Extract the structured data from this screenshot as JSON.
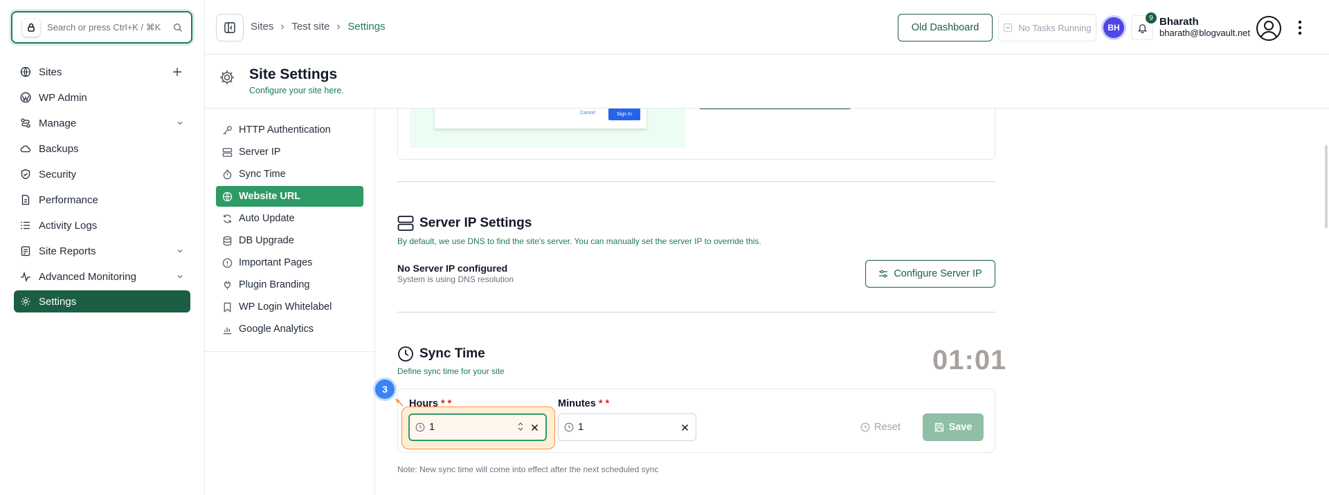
{
  "search": {
    "placeholder": "Search or press Ctrl+K / ⌘K"
  },
  "sidebar": {
    "items": [
      {
        "label": "Sites",
        "icon": "globe-icon"
      },
      {
        "label": "WP Admin",
        "icon": "wordpress-icon"
      },
      {
        "label": "Manage",
        "icon": "manage-icon"
      },
      {
        "label": "Backups",
        "icon": "cloud-icon"
      },
      {
        "label": "Security",
        "icon": "shield-icon"
      },
      {
        "label": "Performance",
        "icon": "document-icon"
      },
      {
        "label": "Activity Logs",
        "icon": "list-icon"
      },
      {
        "label": "Site Reports",
        "icon": "report-icon"
      },
      {
        "label": "Advanced Monitoring",
        "icon": "pulse-icon"
      },
      {
        "label": "Settings",
        "icon": "gear-icon"
      }
    ]
  },
  "header": {
    "breadcrumbs": [
      "Sites",
      "Test site",
      "Settings"
    ],
    "old_dashboard": "Old Dashboard",
    "tasks": "No Tasks Running",
    "avatar_initials": "BH",
    "notif_count": "9",
    "user_name": "Bharath",
    "user_email": "bharath@blogvault.net"
  },
  "page": {
    "title": "Site Settings",
    "subtitle": "Configure your site here."
  },
  "settings_nav": [
    {
      "label": "HTTP Authentication",
      "icon": "key-icon"
    },
    {
      "label": "Server IP",
      "icon": "server-icon"
    },
    {
      "label": "Sync Time",
      "icon": "timer-icon"
    },
    {
      "label": "Website URL",
      "icon": "globe-icon"
    },
    {
      "label": "Auto Update",
      "icon": "refresh-icon"
    },
    {
      "label": "DB Upgrade",
      "icon": "database-icon"
    },
    {
      "label": "Important Pages",
      "icon": "info-icon"
    },
    {
      "label": "Plugin Branding",
      "icon": "plug-icon"
    },
    {
      "label": "WP Login Whitelabel",
      "icon": "bookmark-icon"
    },
    {
      "label": "Google Analytics",
      "icon": "chart-icon"
    }
  ],
  "login_preview": {
    "cancel": "Cancel",
    "sign_in": "Sign In"
  },
  "server_ip": {
    "title": "Server IP Settings",
    "desc": "By default, we use DNS to find the site's server. You can manually set the server IP to override this.",
    "status": "No Server IP configured",
    "status_sub": "System is using DNS resolution",
    "button": "Configure Server IP"
  },
  "sync_time": {
    "title": "Sync Time",
    "desc": "Define sync time for your site",
    "clock": "01:01",
    "hours_label": "Hours",
    "minutes_label": "Minutes",
    "hours_value": "1",
    "minutes_value": "1",
    "reset": "Reset",
    "save": "Save",
    "note": "Note: New sync time will come into effect after the next scheduled sync",
    "step_badge": "3"
  },
  "colors": {
    "brand": "#1b5e43",
    "accent": "#2e9a66",
    "highlight": "#fb923c"
  }
}
